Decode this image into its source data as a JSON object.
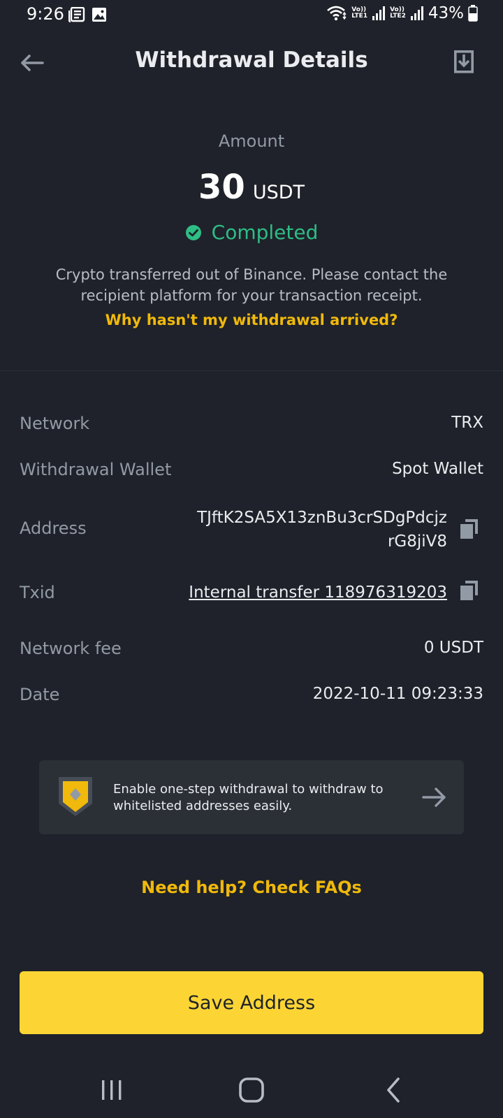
{
  "status_bar": {
    "time": "9:26",
    "sim1_tag_top": "Vo))",
    "sim1_tag_bottom": "LTE1",
    "sim2_tag_top": "Vo))",
    "sim2_tag_bottom": "LTE2",
    "battery": "43%",
    "icons": [
      "news-icon",
      "gallery-icon",
      "wifi-icon",
      "signal-icon",
      "battery-icon"
    ]
  },
  "header": {
    "title": "Withdrawal Details",
    "back_icon": "arrow-left-icon",
    "export_icon": "download-receipt-icon"
  },
  "summary": {
    "amount_label": "Amount",
    "amount_value": "30",
    "amount_unit": "USDT",
    "status": "Completed",
    "status_color": "#2ebd85",
    "description": "Crypto transferred out of Binance. Please contact the recipient platform for your transaction receipt.",
    "help_link": "Why hasn't my withdrawal arrived?"
  },
  "details": {
    "network_label": "Network",
    "network_value": "TRX",
    "wallet_label": "Withdrawal Wallet",
    "wallet_value": "Spot Wallet",
    "address_label": "Address",
    "address_line1": "TJftK2SA5X13znBu3crSDgPdcjz",
    "address_line2": "rG8jiV8",
    "txid_label": "Txid",
    "txid_value": "Internal transfer 118976319203",
    "fee_label": "Network fee",
    "fee_value": "0 USDT",
    "date_label": "Date",
    "date_value": "2022-10-11 09:23:33"
  },
  "promo": {
    "text": "Enable one-step withdrawal to withdraw to whitelisted addresses easily.",
    "accent": "#f0b90b"
  },
  "faq_link": "Need help? Check FAQs",
  "save_button": "Save Address",
  "colors": {
    "background": "#1f222a",
    "accent": "#fcd535"
  }
}
